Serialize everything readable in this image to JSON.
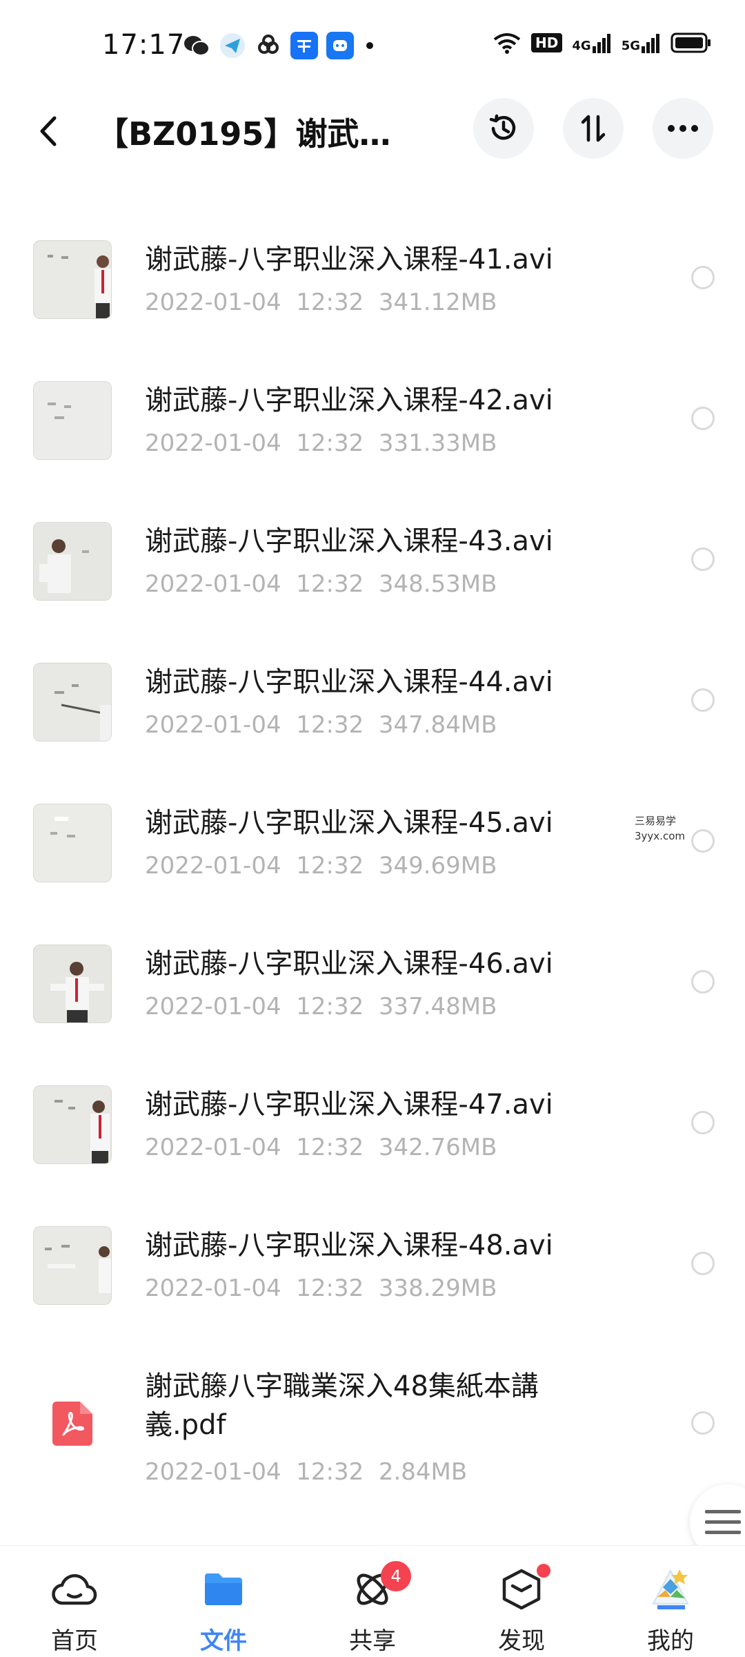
{
  "status_bar": {
    "time": "17:17",
    "network_4g": "4G",
    "network_5g": "5G",
    "hd_badge": "HD"
  },
  "header": {
    "title": "【BZ0195】谢武藤-..."
  },
  "files": [
    {
      "name": "谢武藤-八字职业深入课程-41.avi",
      "date": "2022-01-04",
      "time": "12:32",
      "size": "341.12MB",
      "type": "video"
    },
    {
      "name": "谢武藤-八字职业深入课程-42.avi",
      "date": "2022-01-04",
      "time": "12:32",
      "size": "331.33MB",
      "type": "video"
    },
    {
      "name": "谢武藤-八字职业深入课程-43.avi",
      "date": "2022-01-04",
      "time": "12:32",
      "size": "348.53MB",
      "type": "video"
    },
    {
      "name": "谢武藤-八字职业深入课程-44.avi",
      "date": "2022-01-04",
      "time": "12:32",
      "size": "347.84MB",
      "type": "video"
    },
    {
      "name": "谢武藤-八字职业深入课程-45.avi",
      "date": "2022-01-04",
      "time": "12:32",
      "size": "349.69MB",
      "type": "video"
    },
    {
      "name": "谢武藤-八字职业深入课程-46.avi",
      "date": "2022-01-04",
      "time": "12:32",
      "size": "337.48MB",
      "type": "video"
    },
    {
      "name": "谢武藤-八字职业深入课程-47.avi",
      "date": "2022-01-04",
      "time": "12:32",
      "size": "342.76MB",
      "type": "video"
    },
    {
      "name": "谢武藤-八字职业深入课程-48.avi",
      "date": "2022-01-04",
      "time": "12:32",
      "size": "338.29MB",
      "type": "video"
    },
    {
      "name": "謝武籐八字職業深入48集紙本講義.pdf",
      "date": "2022-01-04",
      "time": "12:32",
      "size": "2.84MB",
      "type": "pdf"
    }
  ],
  "watermark": {
    "line1": "三易易学",
    "line2": "3yyx.com"
  },
  "bottom_nav": [
    {
      "label": "首页",
      "icon": "cloud-icon",
      "active": false
    },
    {
      "label": "文件",
      "icon": "folder-icon",
      "active": true
    },
    {
      "label": "共享",
      "icon": "orbit-icon",
      "active": false,
      "badge": "4"
    },
    {
      "label": "发现",
      "icon": "cube-icon",
      "active": false,
      "dot": true
    },
    {
      "label": "我的",
      "icon": "avatar",
      "active": false
    }
  ],
  "colors": {
    "accent": "#3f86f5",
    "badge": "#f44250",
    "meta_text": "#b3b3b3",
    "pdf_icon": "#f25860"
  }
}
